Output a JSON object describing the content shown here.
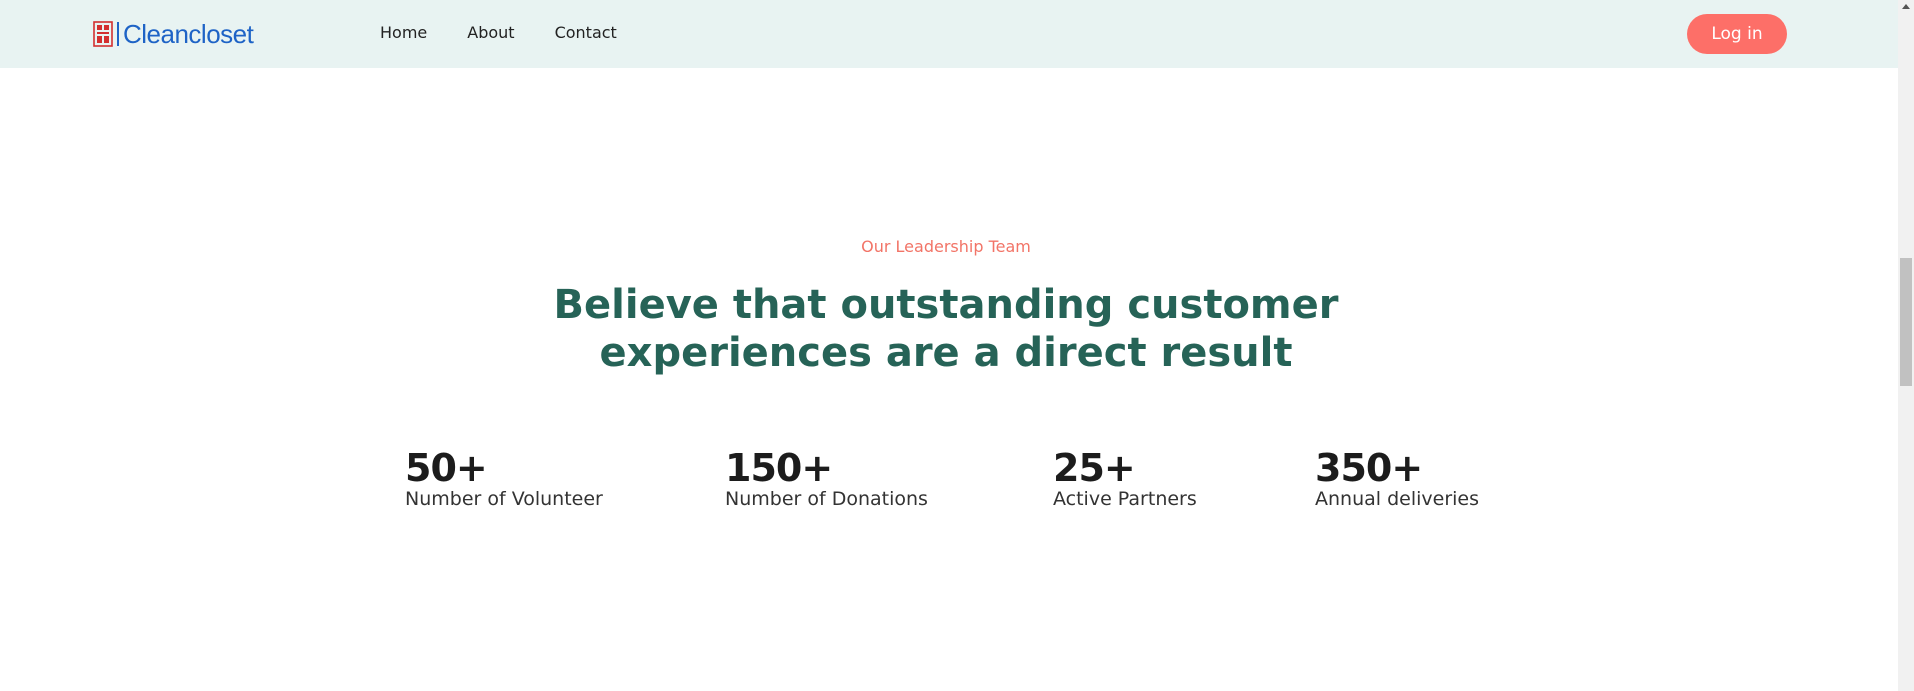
{
  "header": {
    "logo_text": "Cleancloset",
    "nav": [
      {
        "label": "Home"
      },
      {
        "label": "About"
      },
      {
        "label": "Contact"
      }
    ],
    "login_label": "Log in"
  },
  "section": {
    "eyebrow": "Our Leadership Team",
    "headline_line1": "Believe that outstanding customer",
    "headline_line2": "experiences are a direct result"
  },
  "stats": [
    {
      "value": "50+",
      "label": "Number of Volunteer"
    },
    {
      "value": "150+",
      "label": "Number of Donations"
    },
    {
      "value": "25+",
      "label": "Active Partners"
    },
    {
      "value": "350+",
      "label": "Annual deliveries"
    }
  ],
  "colors": {
    "header_bg": "#e8f3f2",
    "brand_blue": "#1e63c6",
    "accent_coral": "#fd6f68",
    "headline_green": "#266357"
  }
}
